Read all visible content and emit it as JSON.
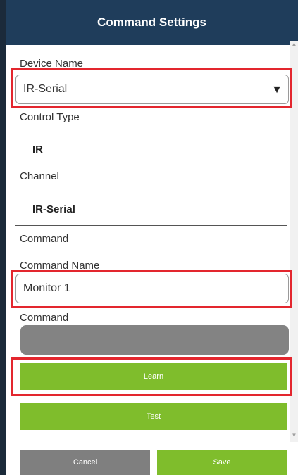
{
  "header": {
    "title": "Command Settings"
  },
  "form": {
    "device_name_label": "Device Name",
    "device_name_value": "IR-Serial",
    "control_type_label": "Control Type",
    "control_type_value": "IR",
    "channel_label": "Channel",
    "channel_value": "IR-Serial",
    "command_section_label": "Command",
    "command_name_label": "Command Name",
    "command_name_value": "Monitor 1",
    "command_label": "Command",
    "command_value": ""
  },
  "buttons": {
    "learn": "Learn",
    "test": "Test",
    "cancel": "Cancel",
    "save": "Save"
  },
  "icons": {
    "dropdown": "▼",
    "scroll_up": "▲",
    "scroll_down": "▼"
  },
  "colors": {
    "header": "#1f3d5b",
    "accent_green": "#7fbd2c",
    "neutral_gray": "#7f7f7f",
    "highlight_red": "#e3262e"
  }
}
